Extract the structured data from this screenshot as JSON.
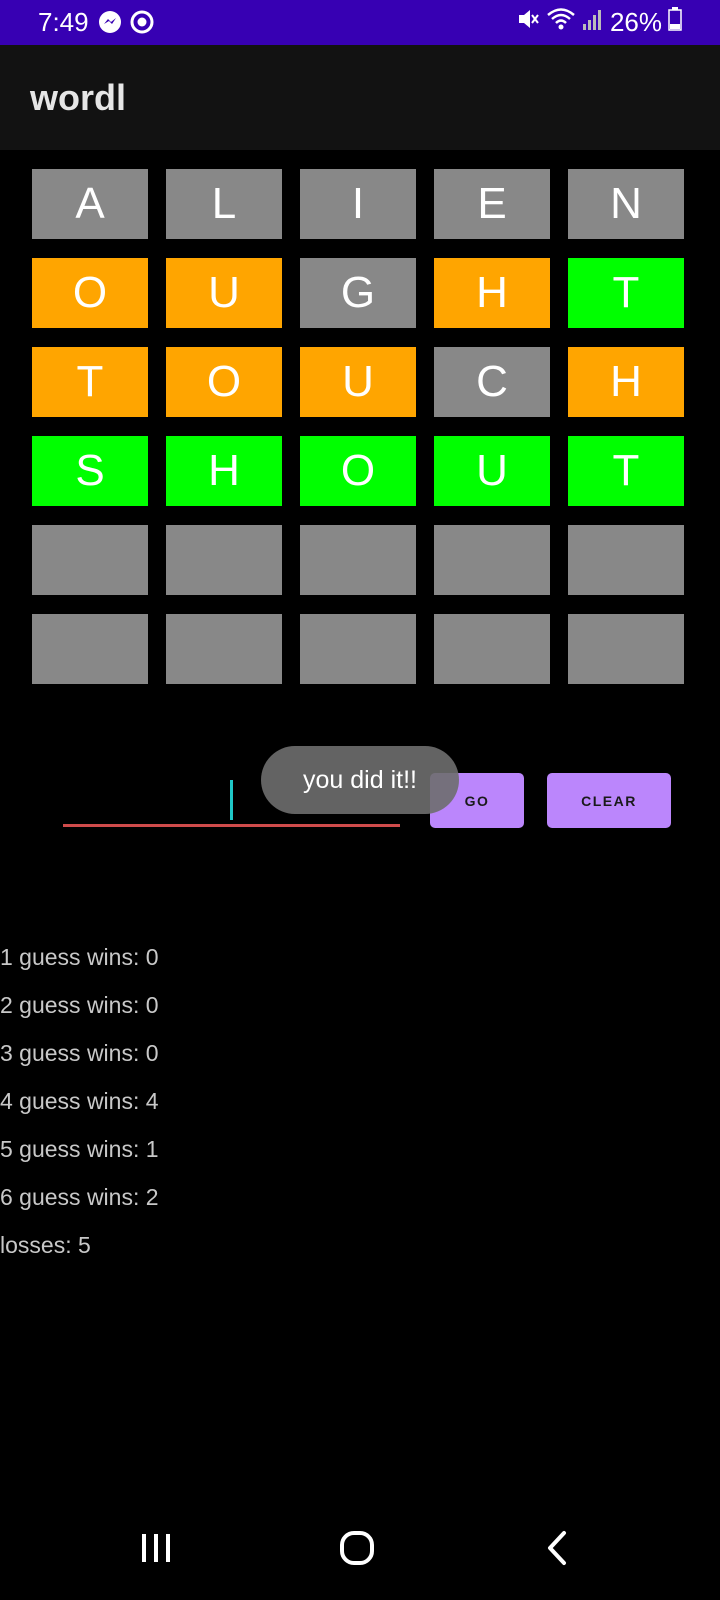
{
  "status_bar": {
    "time": "7:49",
    "battery": "26%",
    "background": "#3700b3"
  },
  "app": {
    "title": "wordl"
  },
  "grid": {
    "rows": [
      [
        {
          "letter": "A",
          "state": "absent"
        },
        {
          "letter": "L",
          "state": "absent"
        },
        {
          "letter": "I",
          "state": "absent"
        },
        {
          "letter": "E",
          "state": "absent"
        },
        {
          "letter": "N",
          "state": "absent"
        }
      ],
      [
        {
          "letter": "O",
          "state": "present"
        },
        {
          "letter": "U",
          "state": "present"
        },
        {
          "letter": "G",
          "state": "absent"
        },
        {
          "letter": "H",
          "state": "present"
        },
        {
          "letter": "T",
          "state": "correct"
        }
      ],
      [
        {
          "letter": "T",
          "state": "present"
        },
        {
          "letter": "O",
          "state": "present"
        },
        {
          "letter": "U",
          "state": "present"
        },
        {
          "letter": "C",
          "state": "absent"
        },
        {
          "letter": "H",
          "state": "present"
        }
      ],
      [
        {
          "letter": "S",
          "state": "correct"
        },
        {
          "letter": "H",
          "state": "correct"
        },
        {
          "letter": "O",
          "state": "correct"
        },
        {
          "letter": "U",
          "state": "correct"
        },
        {
          "letter": "T",
          "state": "correct"
        }
      ],
      [
        {
          "letter": "",
          "state": "absent"
        },
        {
          "letter": "",
          "state": "absent"
        },
        {
          "letter": "",
          "state": "absent"
        },
        {
          "letter": "",
          "state": "absent"
        },
        {
          "letter": "",
          "state": "absent"
        }
      ],
      [
        {
          "letter": "",
          "state": "absent"
        },
        {
          "letter": "",
          "state": "absent"
        },
        {
          "letter": "",
          "state": "absent"
        },
        {
          "letter": "",
          "state": "absent"
        },
        {
          "letter": "",
          "state": "absent"
        }
      ]
    ],
    "colors": {
      "absent": "#888888",
      "present": "#ffa500",
      "correct": "#00ff00"
    }
  },
  "input": {
    "value": "",
    "placeholder": ""
  },
  "buttons": {
    "go_label": "GO",
    "clear_label": "CLEAR",
    "color": "#bb86fc"
  },
  "toast": {
    "message": "you did it!!"
  },
  "stats": [
    "1 guess wins: 0",
    "2 guess wins: 0",
    "3 guess wins: 0",
    "4 guess wins: 4",
    "5 guess wins: 1",
    "6 guess wins: 2",
    "losses: 5"
  ],
  "icons": {
    "status_left": [
      "messenger-icon",
      "record-icon"
    ],
    "status_right": [
      "mute-icon",
      "wifi-icon",
      "signal-icon",
      "battery-icon"
    ],
    "nav": [
      "recent-apps-icon",
      "home-icon",
      "back-icon"
    ]
  }
}
